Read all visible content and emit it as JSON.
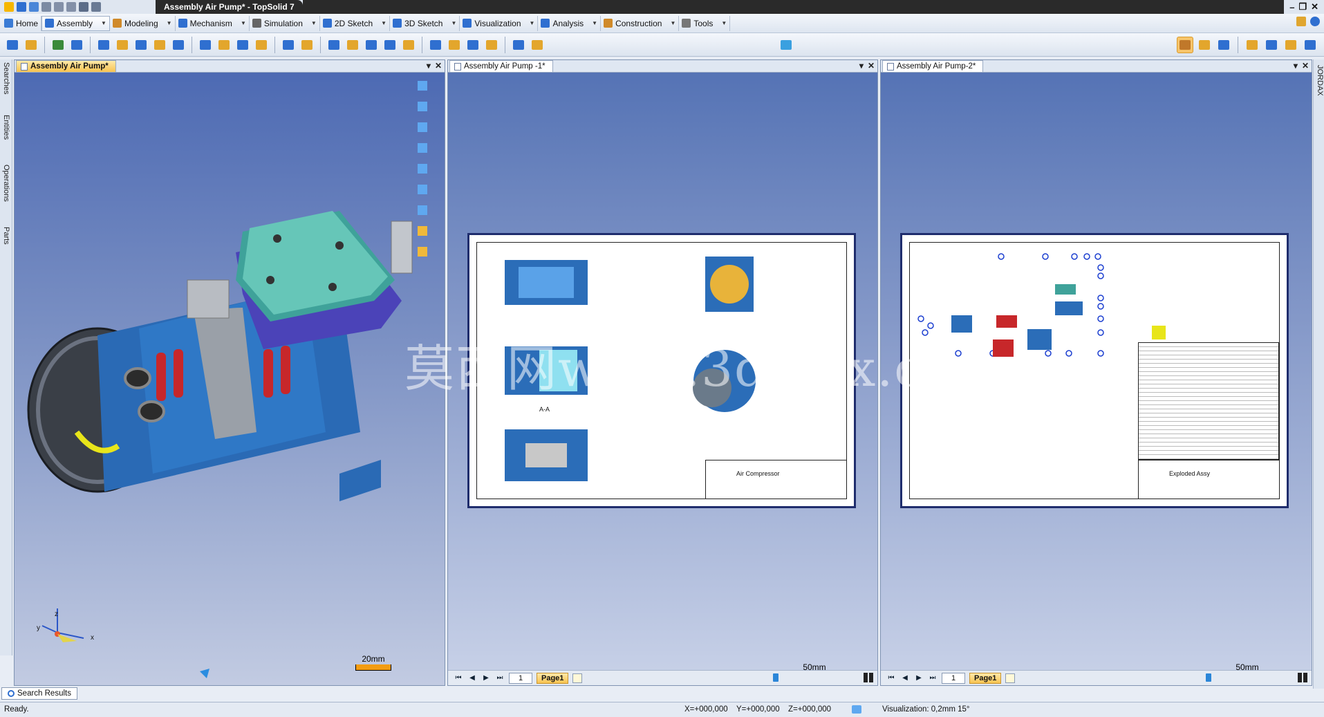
{
  "window": {
    "title": "Assembly Air Pump* - TopSolid 7",
    "controls": [
      "–",
      "❐",
      "✕"
    ]
  },
  "menu": [
    {
      "label": "Home",
      "icon": "home-icon",
      "color": "#3a7bd5"
    },
    {
      "label": "Assembly",
      "icon": "assembly-icon",
      "color": "#2f6fd0"
    },
    {
      "label": "Modeling",
      "icon": "modeling-icon",
      "color": "#d08a2a"
    },
    {
      "label": "Mechanism",
      "icon": "mechanism-icon",
      "color": "#2f6fd0"
    },
    {
      "label": "Simulation",
      "icon": "simulation-icon",
      "color": "#666666"
    },
    {
      "label": "2D Sketch",
      "icon": "sketch2d-icon",
      "color": "#2f6fd0"
    },
    {
      "label": "3D Sketch",
      "icon": "sketch3d-icon",
      "color": "#2f6fd0"
    },
    {
      "label": "Visualization",
      "icon": "visualization-icon",
      "color": "#2f6fd0"
    },
    {
      "label": "Analysis",
      "icon": "analysis-icon",
      "color": "#2f6fd0"
    },
    {
      "label": "Construction",
      "icon": "construction-icon",
      "color": "#d08a2a"
    },
    {
      "label": "Tools",
      "icon": "tools-icon",
      "color": "#777777"
    }
  ],
  "dock": {
    "left_tabs": [
      "Searches",
      "Entities",
      "Operations",
      "Parts"
    ],
    "right_tabs": [
      "JORDAX"
    ]
  },
  "panes": [
    {
      "tab": "Assembly Air Pump*",
      "scale_label": "20mm",
      "view_type": "3d"
    },
    {
      "tab": "Assembly Air Pump -1*",
      "scale_label": "50mm",
      "page_number": "1",
      "page_tab": "Page1",
      "sheet_title": "Air Compressor",
      "section_label": "A-A"
    },
    {
      "tab": "Assembly Air Pump-2*",
      "scale_label": "50mm",
      "page_number": "1",
      "page_tab": "Page1",
      "sheet_title": "Exploded Assy"
    }
  ],
  "axes": {
    "z": "z",
    "y": "y",
    "x": "x"
  },
  "watermark": "莫西网www.3dmox.com",
  "bottom": {
    "search_results": "Search Results"
  },
  "status": {
    "ready": "Ready.",
    "x": "X=+000,000",
    "y": "Y=+000,000",
    "z": "Z=+000,000",
    "visualization": "Visualization: 0,2mm 15°"
  },
  "colors": {
    "active_tab": "#f8c350",
    "sheet_border": "#1f2d6d",
    "accent_blue": "#2f6fd0"
  }
}
